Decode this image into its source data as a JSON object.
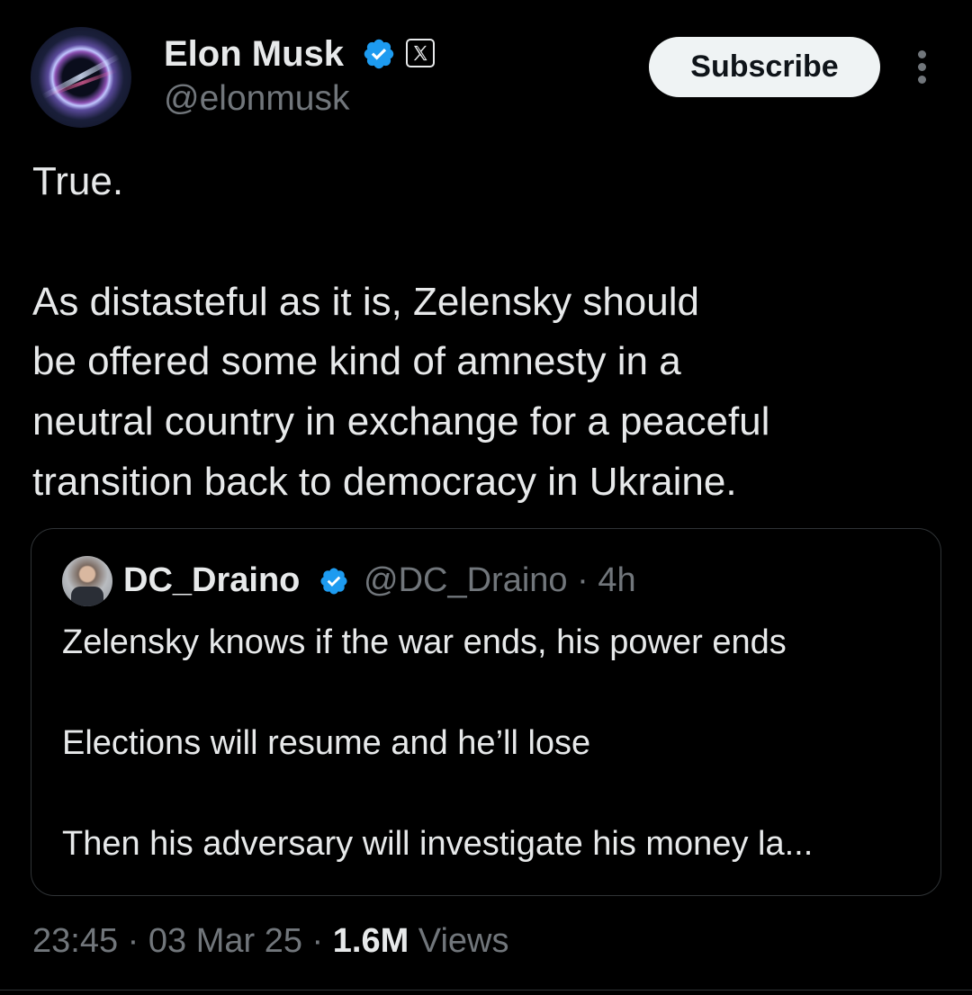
{
  "author": {
    "name": "Elon Musk",
    "handle": "@elonmusk",
    "verified_color": "#1d9bf0",
    "affiliation_icon": "x-logo-icon"
  },
  "actions": {
    "subscribe_label": "Subscribe",
    "more_icon": "more-vertical-icon"
  },
  "tweet": {
    "lines": [
      "True.",
      "As distasteful as it is, Zelensky should",
      "be offered some kind of amnesty in a",
      "neutral country in exchange for a peaceful",
      "transition back to democracy in Ukraine."
    ]
  },
  "quoted_tweet": {
    "name": "DC_Draino",
    "handle": "@DC_Draino",
    "time": "· 4h",
    "lines": [
      "Zelensky knows if the war ends, his power ends",
      "Elections will resume and he’ll lose",
      "Then his adversary will investigate his money la..."
    ]
  },
  "meta": {
    "time": "23:45",
    "sep1": "·",
    "date": "03 Mar 25",
    "sep2": "·",
    "views_count": "1.6M",
    "views_label": "Views"
  },
  "colors": {
    "background": "#000000",
    "text_primary": "#e7e9ea",
    "text_secondary": "#71767b",
    "border": "#2f3336"
  }
}
